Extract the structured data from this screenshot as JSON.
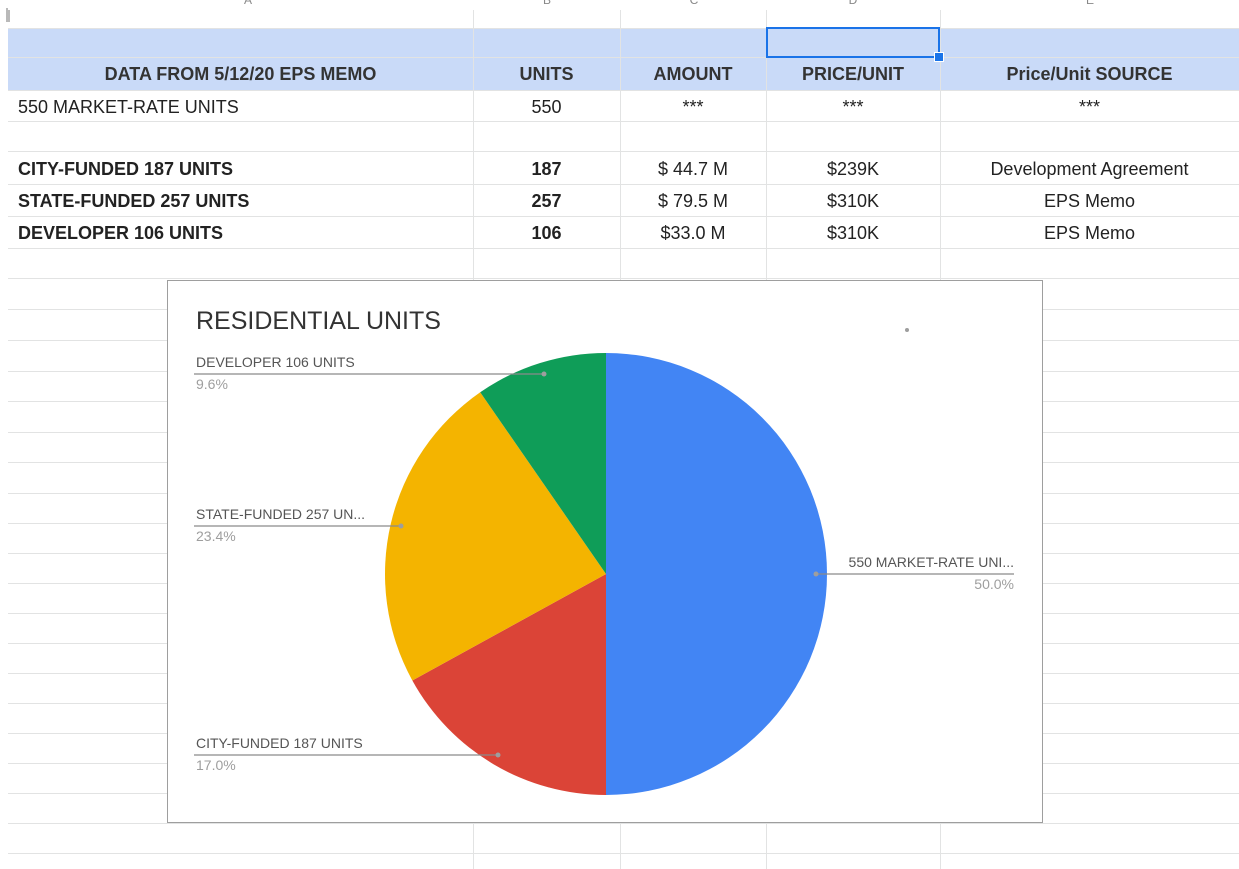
{
  "column_headers": [
    "A",
    "B",
    "C",
    "D",
    "E"
  ],
  "table": {
    "headers": [
      "DATA FROM 5/12/20 EPS MEMO",
      "UNITS",
      "AMOUNT",
      "PRICE/UNIT",
      "Price/Unit SOURCE"
    ],
    "rows": [
      {
        "label": "550 MARKET-RATE UNITS",
        "units": "550",
        "amount": "***",
        "price": "***",
        "source": "***"
      },
      {
        "label": "CITY-FUNDED 187 UNITS",
        "units": "187",
        "amount": "$ 44.7 M",
        "price": "$239K",
        "source": "Development Agreement"
      },
      {
        "label": "STATE-FUNDED 257 UNITS",
        "units": "257",
        "amount": "$ 79.5 M",
        "price": "$310K",
        "source": "EPS Memo"
      },
      {
        "label": "DEVELOPER 106 UNITS",
        "units": "106",
        "amount": "$33.0 M",
        "price": "$310K",
        "source": "EPS Memo"
      }
    ]
  },
  "chart": {
    "labels": {
      "market": "550 MARKET-RATE UNI...",
      "city": "CITY-FUNDED 187 UNITS",
      "state": "STATE-FUNDED 257 UN...",
      "developer": "DEVELOPER 106 UNITS"
    },
    "percents": {
      "market": "50.0%",
      "city": "17.0%",
      "state": "23.4%",
      "developer": "9.6%"
    }
  },
  "chart_data": {
    "type": "pie",
    "title": "RESIDENTIAL UNITS",
    "categories": [
      "550 MARKET-RATE UNITS",
      "CITY-FUNDED 187 UNITS",
      "STATE-FUNDED 257 UNITS",
      "DEVELOPER 106 UNITS"
    ],
    "values": [
      550,
      187,
      257,
      106
    ],
    "colors": [
      "#4285f4",
      "#db4437",
      "#f4b400",
      "#0f9d58"
    ]
  }
}
